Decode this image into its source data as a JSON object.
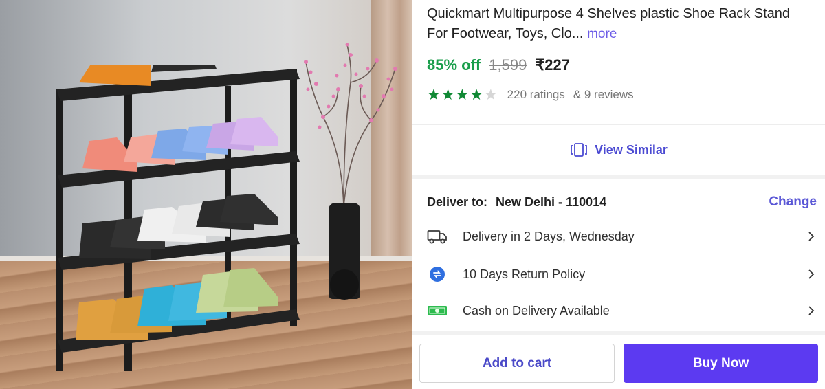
{
  "product": {
    "title": "Quickmart Multipurpose 4 Shelves plastic Shoe Rack Stand For Footwear, Toys, Clo...",
    "more_label": "more",
    "discount": "85% off",
    "mrp": "1,599",
    "price": "₹227",
    "rating_value": 4,
    "rating_max": 5,
    "ratings_text": "220 ratings",
    "reviews_text": "& 9 reviews"
  },
  "actions": {
    "view_similar_label": "View Similar",
    "add_to_cart_label": "Add to cart",
    "buy_now_label": "Buy Now"
  },
  "delivery": {
    "deliver_to_label": "Deliver to:",
    "location": "New Delhi - 110014",
    "change_label": "Change",
    "items": [
      {
        "icon": "truck-icon",
        "label": "Delivery in 2 Days, Wednesday"
      },
      {
        "icon": "return-icon",
        "label": "10 Days Return Policy"
      },
      {
        "icon": "cash-icon",
        "label": "Cash on Delivery Available"
      }
    ]
  },
  "colors": {
    "discount": "#1a9e4b",
    "star": "#108934",
    "accent": "#5a57d6",
    "buy_button": "#5c3af1"
  }
}
